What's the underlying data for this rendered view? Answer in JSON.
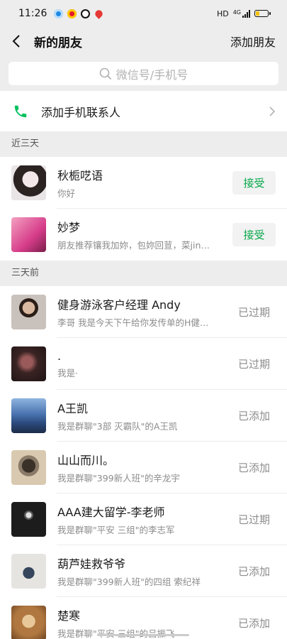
{
  "status_bar": {
    "time": "11:26",
    "hd": "HD",
    "network": "4G",
    "app_icons": [
      "tencent-icon",
      "weibo-icon",
      "qq-browser-icon",
      "map-pin-icon"
    ],
    "battery_color": "#f2c200"
  },
  "nav": {
    "title": "新的朋友",
    "action": "添加朋友"
  },
  "search": {
    "placeholder": "微信号/手机号"
  },
  "add_phone": {
    "label": "添加手机联系人",
    "icon_color": "#07c160"
  },
  "sections": [
    {
      "title": "近三天",
      "items": [
        {
          "name": "秋栀呓语",
          "message": "你好",
          "action": "接受",
          "avatar_colors": [
            "#e9e4e6",
            "#2b2222"
          ]
        },
        {
          "name": "妙梦",
          "message": "朋友推荐镶我加妳，包妳回荁，菜jin…",
          "action": "接受",
          "avatar_colors": [
            "#d63d8a",
            "#f4a0c0"
          ]
        }
      ]
    },
    {
      "title": "三天前",
      "items": [
        {
          "name": "健身游泳客户经理   Andy",
          "message": "李哥  我是今天下午给你发传单的H健…",
          "action": "已过期",
          "avatar_colors": [
            "#c9c2bc",
            "#2b1e18"
          ]
        },
        {
          "name": ".",
          "message": "我是·",
          "action": "已过期",
          "avatar_colors": [
            "#3a2323",
            "#9a5a5a"
          ]
        },
        {
          "name": "A王凯",
          "message": "我是群聊\"3部 灭霸队\"的A王凯",
          "action": "已添加",
          "avatar_colors": [
            "#2c4c80",
            "#8fb4e0"
          ]
        },
        {
          "name": "山山而川。",
          "message": "我是群聊\"399新人班\"的辛龙宇",
          "action": "已添加",
          "avatar_colors": [
            "#d9c9b0",
            "#3a3128"
          ]
        },
        {
          "name": "AAA建大留学-李老师",
          "message": "我是群聊\"平安  三组\"的李志军",
          "action": "已过期",
          "avatar_colors": [
            "#1c1c1c",
            "#5a5a5a"
          ]
        },
        {
          "name": "葫芦娃救爷爷",
          "message": "我是群聊\"399新人班\"的四组 索纪祥",
          "action": "已添加",
          "avatar_colors": [
            "#e6e4e0",
            "#35465c"
          ]
        },
        {
          "name": "楚寒",
          "message": "我是群聊\"平安  三组\"的吕振飞",
          "action": "已添加",
          "avatar_colors": [
            "#b07840",
            "#e8c898"
          ]
        }
      ]
    }
  ]
}
